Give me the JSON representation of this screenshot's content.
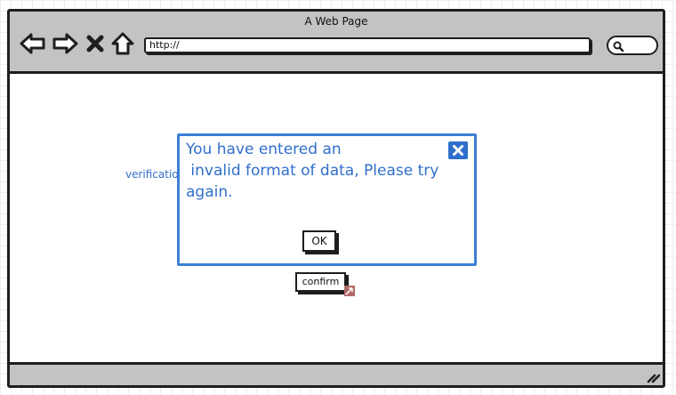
{
  "window": {
    "title": "A Web Page"
  },
  "toolbar": {
    "icons": [
      "back-arrow-icon",
      "forward-arrow-icon",
      "close-x-icon",
      "home-icon"
    ],
    "address": "http://",
    "search_icon": "search-icon"
  },
  "page": {
    "field_label": "verification",
    "confirm_label": "confirm"
  },
  "dialog": {
    "message": "You have entered an\n invalid format of data, Please try\nagain.",
    "ok_label": "OK",
    "close_icon": "close-icon"
  },
  "colors": {
    "frame": "#1e1e1e",
    "chrome": "#c3c3c3",
    "dialog_accent": "#3d7fd6",
    "text_accent": "#2f6fcb"
  }
}
